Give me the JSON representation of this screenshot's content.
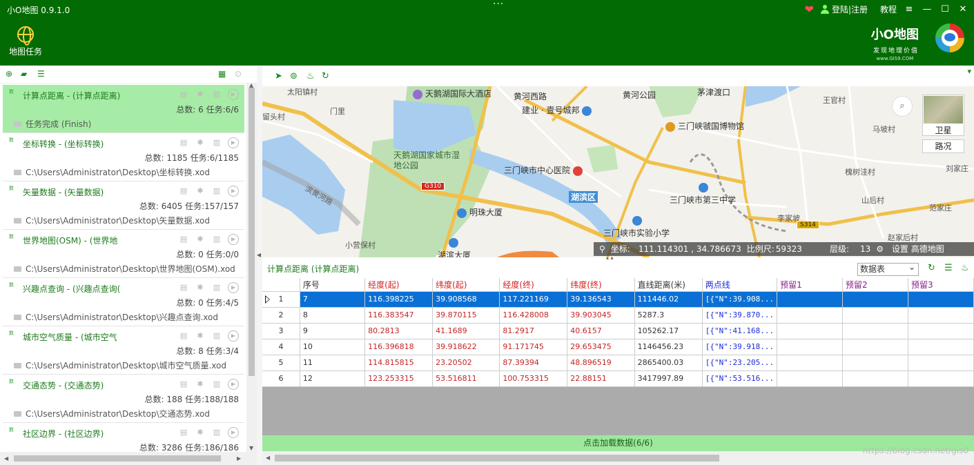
{
  "app": {
    "title": "小O地图 0.9.1.0",
    "login_label": "登陆|注册",
    "tutorial_label": "教程",
    "task_button_label": "地图任务",
    "brand_name": "小O地图",
    "brand_slogan": "发现地理价值",
    "brand_url": "www.GIS9.COM"
  },
  "tasks": [
    {
      "badge": "数",
      "name": "计算点距离 - (计算点距离)",
      "count": "总数: 6 任务:6/6",
      "path": "任务完成 (Finish)",
      "selected": true
    },
    {
      "badge": "数",
      "name": "坐标转换 - (坐标转换)",
      "count": "总数: 1185 任务:6/1185",
      "path": "C:\\Users\\Administrator\\Desktop\\坐标转换.xod"
    },
    {
      "badge": "数",
      "name": "矢量数据 - (矢量数据)",
      "count": "总数: 6405 任务:157/157",
      "path": "C:\\Users\\Administrator\\Desktop\\矢量数据.xod"
    },
    {
      "badge": "数",
      "name": "世界地图(OSM) - (世界地",
      "count": "总数: 0 任务:0/0",
      "path": "C:\\Users\\Administrator\\Desktop\\世界地图(OSM).xod"
    },
    {
      "badge": "数",
      "name": "兴趣点查询 - (兴趣点查询(",
      "count": "总数: 0 任务:4/5",
      "path": "C:\\Users\\Administrator\\Desktop\\兴趣点查询.xod"
    },
    {
      "badge": "数",
      "name": "城市空气质量 - (城市空气",
      "count": "总数: 8 任务:3/4",
      "path": "C:\\Users\\Administrator\\Desktop\\城市空气质量.xod"
    },
    {
      "badge": "数",
      "name": "交通态势 - (交通态势)",
      "count": "总数: 188 任务:188/188",
      "path": "C:\\Users\\Administrator\\Desktop\\交通态势.xod"
    },
    {
      "badge": "数",
      "name": "社区边界 - (社区边界)",
      "count": "总数: 3286 任务:186/186",
      "path": ""
    }
  ],
  "map": {
    "labels": {
      "hotel": "天鹅湖国际大酒店",
      "huanghe_west": "黄河西路",
      "huanghe_park": "黄河公园",
      "maojin": "茅津渡口",
      "wangguan": "王官村",
      "jianye": "建业 · 壹号城邦",
      "museum": "三门峡虢国博物馆",
      "mapo": "马坡村",
      "liuxi": "留头村",
      "yangzhen": "太阳镇村",
      "menli": "门里",
      "wetland": "天鹅湖国家城市湿地公园",
      "hospital": "三门峡市中心医院",
      "huaishu": "槐树洼村",
      "liujia": "刘家庄",
      "hubin": "湖滨区",
      "school3": "三门峡市第三中学",
      "shanhou": "山后村",
      "mingzhu": "明珠大厦",
      "lijia": "李家坡",
      "fanjia": "范家庄",
      "school_exp": "三门峡市实验小学",
      "zhaojia": "赵家后村",
      "hubin_tower": "湖滨大厦",
      "road_name": "滨黄河路",
      "xiaozhuang": "小营保村"
    },
    "highway_g310": "G310",
    "highway_s314": "S314",
    "satellite_label": "卫星",
    "road_label": "路况",
    "status": {
      "coord_label": "坐标:",
      "coord_value": "111.114301 , 34.786673",
      "scale_label": "比例尺:",
      "scale_value": "59323",
      "level_label": "层级:",
      "level_value": "13",
      "settings_label": "设置 高德地图"
    }
  },
  "data_panel": {
    "title": "计算点距离 (计算点距离)",
    "view_select": "数据表",
    "load_label": "点击加载数据(6/6)",
    "columns": [
      "序号",
      "经度(起)",
      "纬度(起)",
      "经度(终)",
      "纬度(终)",
      "直线距离(米)",
      "两点线",
      "预留1",
      "预留2",
      "预留3"
    ],
    "rows": [
      {
        "idx": "1",
        "cells": [
          "7",
          "116.398225",
          "39.908568",
          "117.221169",
          "39.136543",
          "111446.02",
          "[{\"N\":39.908...",
          "",
          "",
          ""
        ],
        "selected": true
      },
      {
        "idx": "2",
        "cells": [
          "8",
          "116.383547",
          "39.870115",
          "116.428008",
          "39.903045",
          "5287.3",
          "[{\"N\":39.870...",
          "",
          "",
          ""
        ]
      },
      {
        "idx": "3",
        "cells": [
          "9",
          "80.2813",
          "41.1689",
          "81.2917",
          "40.6157",
          "105262.17",
          "[{\"N\":41.168...",
          "",
          "",
          ""
        ]
      },
      {
        "idx": "4",
        "cells": [
          "10",
          "116.396818",
          "39.918622",
          "91.171745",
          "29.653475",
          "1146456.23",
          "[{\"N\":39.918...",
          "",
          "",
          ""
        ]
      },
      {
        "idx": "5",
        "cells": [
          "11",
          "114.815815",
          "23.20502",
          "87.39394",
          "48.896519",
          "2865400.03",
          "[{\"N\":23.205...",
          "",
          "",
          ""
        ]
      },
      {
        "idx": "6",
        "cells": [
          "12",
          "123.253315",
          "53.516811",
          "100.753315",
          "22.88151",
          "3417997.89",
          "[{\"N\":53.516...",
          "",
          "",
          ""
        ]
      }
    ]
  },
  "watermark": "https://blog.csdn.net/gis0"
}
